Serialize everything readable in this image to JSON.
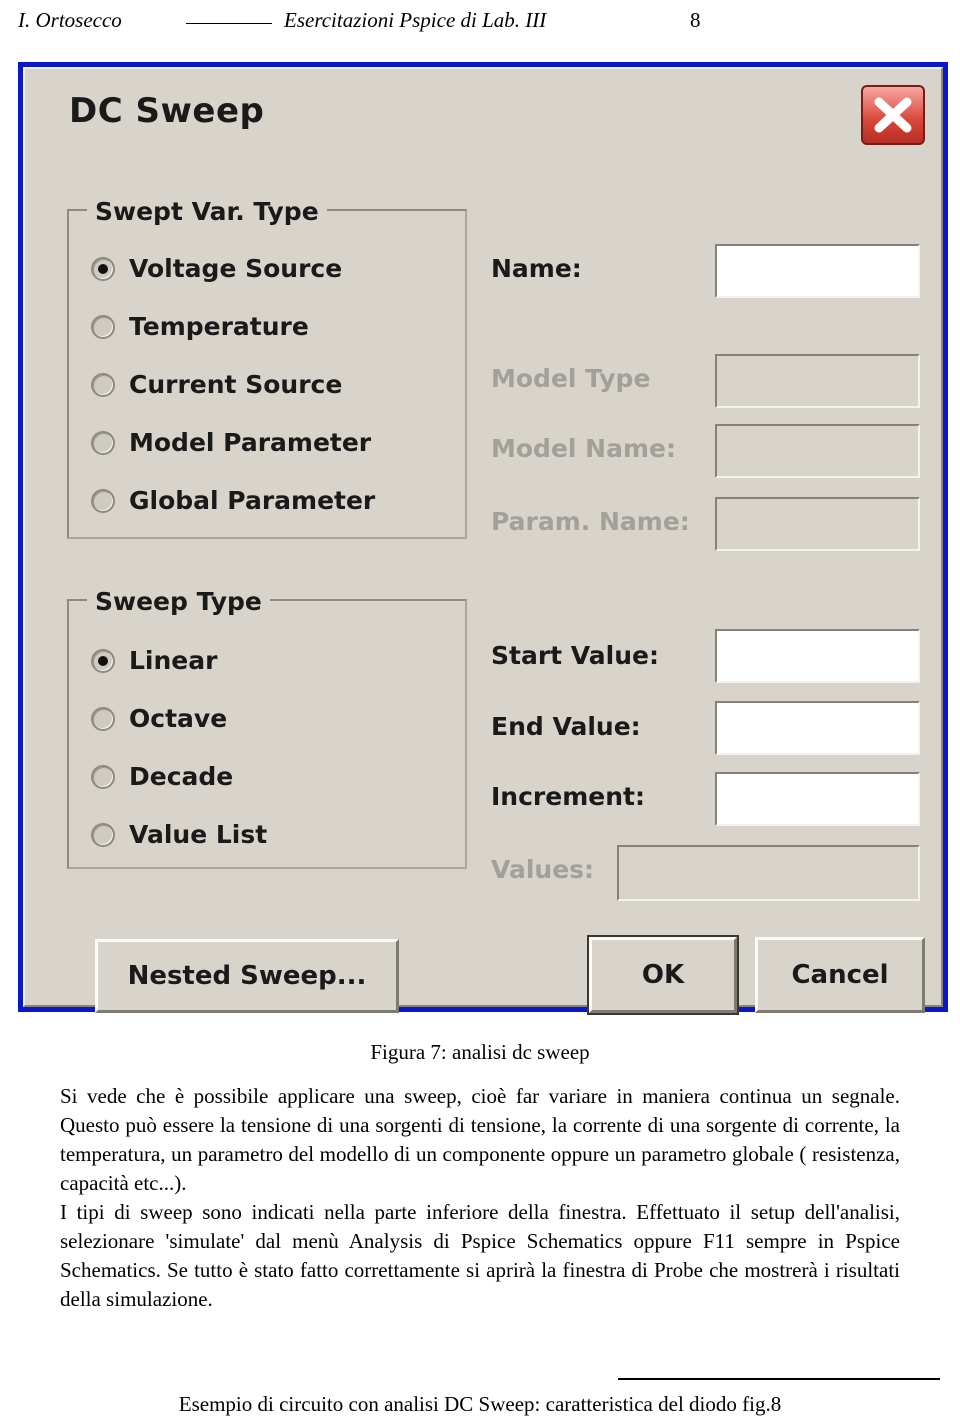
{
  "header": {
    "left": "I. Ortosecco",
    "center": "Esercitazioni Pspice di Lab. III",
    "page_number": "8"
  },
  "dialog": {
    "title": "DC Sweep",
    "close_label": "×",
    "groups": [
      {
        "label": "Swept Var. Type",
        "options": [
          {
            "label": "Voltage Source",
            "selected": true
          },
          {
            "label": "Temperature",
            "selected": false
          },
          {
            "label": "Current Source",
            "selected": false
          },
          {
            "label": "Model Parameter",
            "selected": false
          },
          {
            "label": "Global Parameter",
            "selected": false
          }
        ]
      },
      {
        "label": "Sweep Type",
        "options": [
          {
            "label": "Linear",
            "selected": true
          },
          {
            "label": "Octave",
            "selected": false
          },
          {
            "label": "Decade",
            "selected": false
          },
          {
            "label": "Value List",
            "selected": false
          }
        ]
      }
    ],
    "fields": [
      {
        "label": "Name:",
        "value": "",
        "enabled": true
      },
      {
        "label": "Model Type",
        "value": "",
        "enabled": false
      },
      {
        "label": "Model Name:",
        "value": "",
        "enabled": false
      },
      {
        "label": "Param. Name:",
        "value": "",
        "enabled": false
      },
      {
        "label": "Start Value:",
        "value": "",
        "enabled": true
      },
      {
        "label": "End Value:",
        "value": "",
        "enabled": true
      },
      {
        "label": "Increment:",
        "value": "",
        "enabled": true
      },
      {
        "label": "Values:",
        "value": "",
        "enabled": false
      }
    ],
    "buttons": {
      "nested_sweep": "Nested Sweep...",
      "ok": "OK",
      "cancel": "Cancel"
    }
  },
  "caption": "Figura 7: analisi dc sweep",
  "body": {
    "p1": "Si vede che è possibile applicare una sweep, cioè far variare in maniera continua un segnale. Questo può essere la tensione di una sorgenti di tensione, la corrente di una sorgente di corrente, la temperatura, un parametro del modello di un componente oppure un parametro globale ( resistenza, capacità etc...).",
    "p2": "I tipi di sweep sono indicati nella parte inferiore della finestra. Effettuato il setup dell'analisi, selezionare 'simulate' dal menù Analysis di Pspice Schematics oppure F11 sempre in Pspice Schematics. Se tutto è stato fatto correttamente si aprirà la finestra di Probe che mostrerà i risultati della simulazione."
  },
  "footer": {
    "text": "Esempio di circuito con analisi DC Sweep: caratteristica del diodo fig.8"
  }
}
